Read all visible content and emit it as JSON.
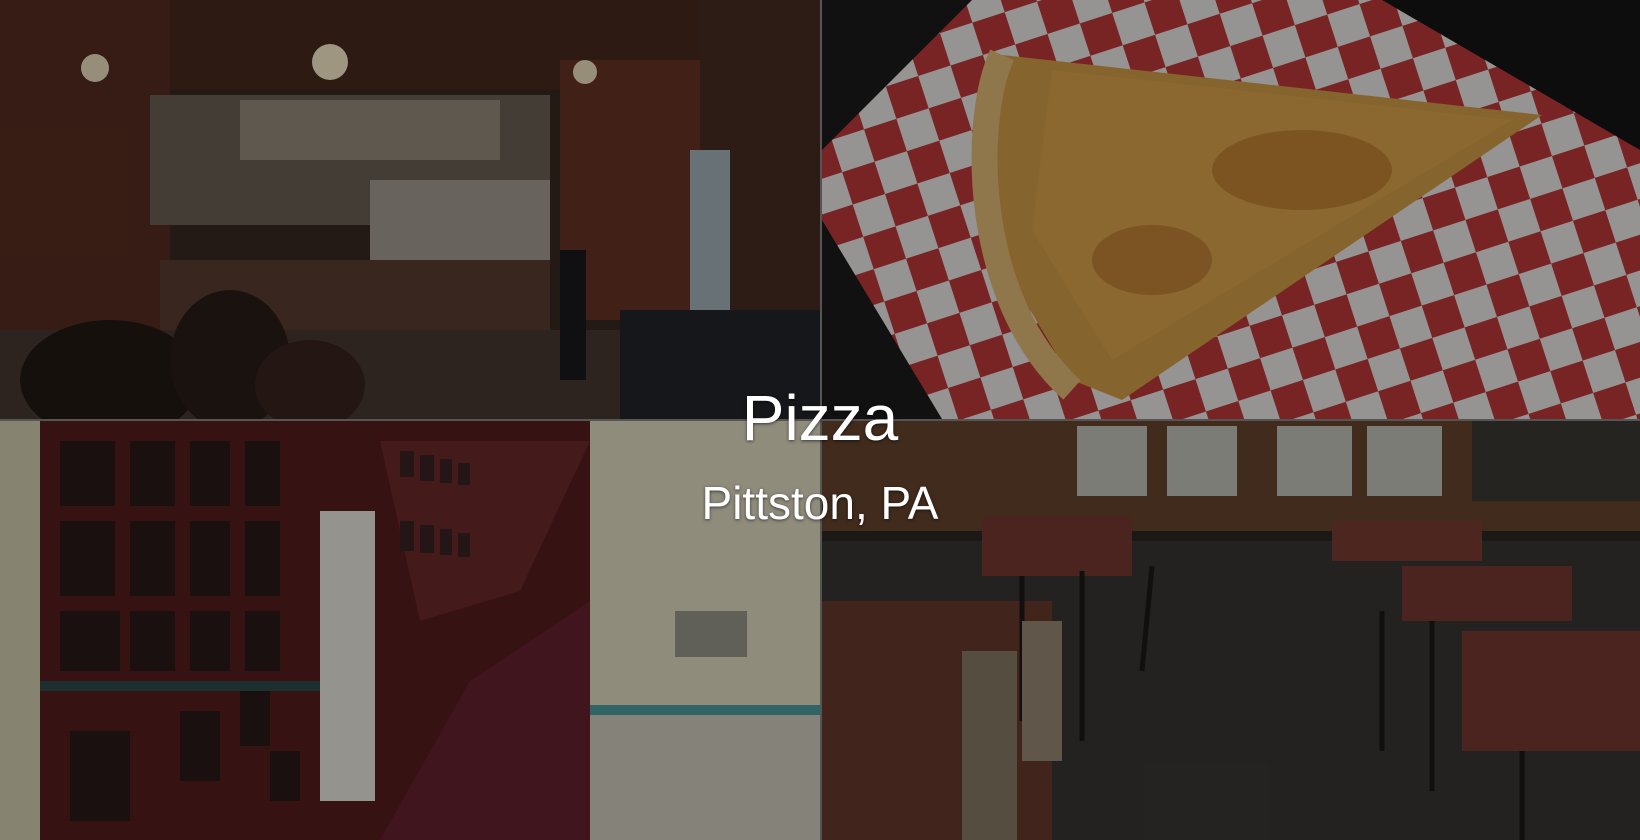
{
  "caption": {
    "title": "Pizza",
    "subtitle": "Pittston, PA"
  },
  "photos": [
    {
      "scene": "restaurant-counter-interior",
      "palette": [
        "#5a3a2a",
        "#2a1e18",
        "#c9b89a"
      ]
    },
    {
      "scene": "pizza-slice-on-checkered-paper",
      "palette": [
        "#c0392b",
        "#ffffff",
        "#d9a441"
      ]
    },
    {
      "scene": "hallway-with-framed-photos",
      "palette": [
        "#5e1f22",
        "#8a2f3a",
        "#e8e4cf"
      ]
    },
    {
      "scene": "dining-room-tables",
      "palette": [
        "#7a3b2e",
        "#4a3a30",
        "#6b5a48"
      ]
    }
  ]
}
